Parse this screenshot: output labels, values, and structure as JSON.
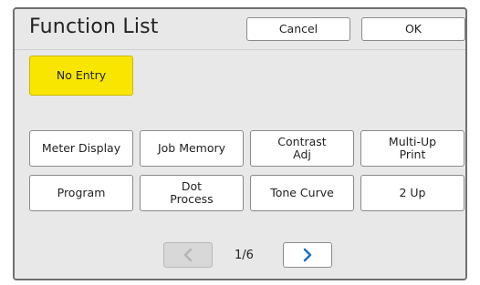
{
  "header": {
    "title": "Function List",
    "cancel_label": "Cancel",
    "ok_label": "OK"
  },
  "entry": {
    "label": "No Entry",
    "color": "#f8e600"
  },
  "functions": [
    {
      "label": "Meter Display"
    },
    {
      "label": "Job Memory"
    },
    {
      "label": "Contrast\nAdj"
    },
    {
      "label": "Multi-Up\nPrint"
    },
    {
      "label": "Program"
    },
    {
      "label": "Dot\nProcess"
    },
    {
      "label": "Tone Curve"
    },
    {
      "label": "2 Up"
    }
  ],
  "pagination": {
    "current": "1/6",
    "prev_icon": "chevron-left-icon",
    "next_icon": "chevron-right-icon",
    "prev_enabled": false,
    "next_enabled": true,
    "accent": "#1a6fd1"
  }
}
